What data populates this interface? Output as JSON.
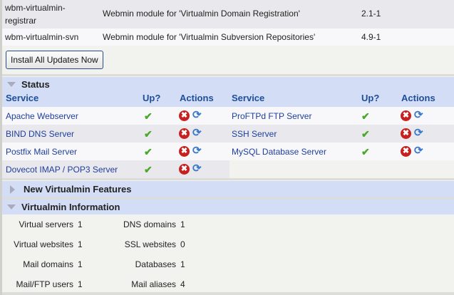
{
  "packages": [
    {
      "name_line1": "wbm-virtualmin-",
      "name_line2": "registrar",
      "description": "Webmin module for 'Virtualmin Domain Registration'",
      "version": "2.1-1"
    },
    {
      "name": "wbm-virtualmin-svn",
      "description": "Webmin module for 'Virtualmin Subversion Repositories'",
      "version": "4.9-1"
    }
  ],
  "install_button": "Install All Updates Now",
  "status": {
    "title": "Status",
    "headers": {
      "service": "Service",
      "up": "Up?",
      "actions": "Actions"
    },
    "left": [
      "Apache Webserver",
      "BIND DNS Server",
      "Postfix Mail Server",
      "Dovecot IMAP / POP3 Server"
    ],
    "right": [
      "ProFTPd FTP Server",
      "SSH Server",
      "MySQL Database Server"
    ],
    "up_glyph": "✔",
    "stop_glyph": "✖",
    "restart_glyph": "⟳"
  },
  "new_features": {
    "title": "New Virtualmin Features"
  },
  "info": {
    "title": "Virtualmin Information",
    "left": [
      {
        "label": "Virtual servers",
        "value": "1"
      },
      {
        "label": "Virtual websites",
        "value": "1"
      },
      {
        "label": "Mail domains",
        "value": "1"
      },
      {
        "label": "Mail/FTP users",
        "value": "1"
      }
    ],
    "right": [
      {
        "label": "DNS domains",
        "value": "1"
      },
      {
        "label": "SSL websites",
        "value": "0"
      },
      {
        "label": "Databases",
        "value": "1"
      },
      {
        "label": "Mail aliases",
        "value": "4"
      }
    ]
  }
}
